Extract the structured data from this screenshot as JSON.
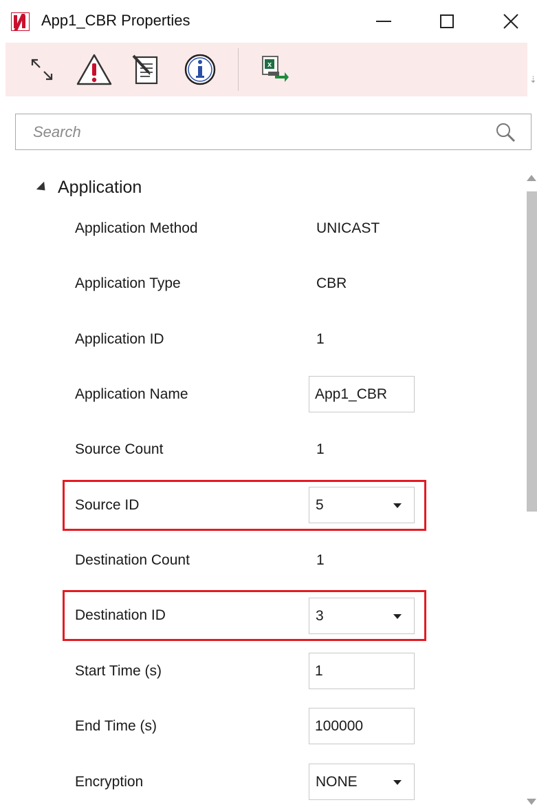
{
  "window": {
    "title": "App1_CBR Properties",
    "controls": [
      "minimize",
      "maximize",
      "close"
    ]
  },
  "toolbar": {
    "buttons": [
      {
        "icon": "expand-arrows-icon"
      },
      {
        "icon": "warning-icon"
      },
      {
        "icon": "notepad-edit-icon"
      },
      {
        "icon": "info-icon"
      },
      {
        "icon": "excel-export-icon"
      }
    ]
  },
  "search": {
    "placeholder": "Search",
    "value": ""
  },
  "section": {
    "title": "Application",
    "expanded": true
  },
  "properties": {
    "application_method": {
      "label": "Application Method",
      "value": "UNICAST"
    },
    "application_type": {
      "label": "Application Type",
      "value": "CBR"
    },
    "application_id": {
      "label": "Application ID",
      "value": "1"
    },
    "application_name": {
      "label": "Application Name",
      "value": "App1_CBR"
    },
    "source_count": {
      "label": "Source Count",
      "value": "1"
    },
    "source_id": {
      "label": "Source ID",
      "value": "5"
    },
    "destination_count": {
      "label": "Destination Count",
      "value": "1"
    },
    "destination_id": {
      "label": "Destination ID",
      "value": "3"
    },
    "start_time": {
      "label": "Start Time (s)",
      "value": "1"
    },
    "end_time": {
      "label": "End Time (s)",
      "value": "100000"
    },
    "encryption": {
      "label": "Encryption",
      "value": "NONE"
    }
  },
  "colors": {
    "toolbar_bg": "#fbeaea",
    "highlight": "#e31b23",
    "logo": "#c8102e"
  }
}
